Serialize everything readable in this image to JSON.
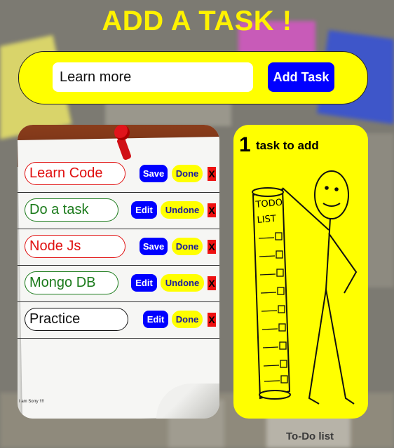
{
  "header": {
    "title": "ADD A TASK !"
  },
  "form": {
    "input_value": "Learn more",
    "add_button_label": "Add Task"
  },
  "tasks": [
    {
      "name": "Learn Code",
      "color": "#e01010",
      "border": "#e01010",
      "primary": "Save",
      "secondary": "Done"
    },
    {
      "name": "Do a task",
      "color": "#1a7a1a",
      "border": "#1a7a1a",
      "primary": "Edit",
      "secondary": "Undone"
    },
    {
      "name": "Node Js",
      "color": "#e01010",
      "border": "#e01010",
      "primary": "Save",
      "secondary": "Done"
    },
    {
      "name": "Mongo DB",
      "color": "#1a7a1a",
      "border": "#1a7a1a",
      "primary": "Edit",
      "secondary": "Undone"
    },
    {
      "name": "Practice",
      "color": "#111111",
      "border": "#111111",
      "primary": "Edit",
      "secondary": "Done"
    }
  ],
  "delete_glyph": "X",
  "card_footer_text": "I am Sorry !!!!",
  "counter": {
    "count": "1",
    "label": "task to add"
  },
  "illustration": {
    "heading": "TODO LIST"
  },
  "background_caption": "To-Do list",
  "colors": {
    "accent_yellow": "#ffff00",
    "accent_blue": "#0000ff",
    "title_yellow": "#fff200"
  }
}
